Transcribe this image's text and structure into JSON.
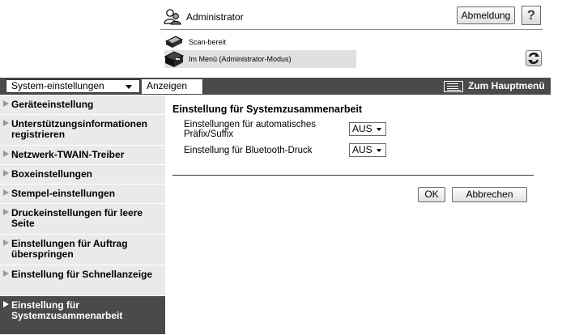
{
  "header": {
    "user_name": "Administrator",
    "logout_label": "Abmeldung",
    "help_label": "?",
    "status_scan": "Scan-bereit",
    "status_mode": "Im Menü (Administrator-Modus)"
  },
  "topbar": {
    "menu_select": "System-einstellungen",
    "display_label": "Anzeigen",
    "main_menu_label": "Zum Hauptmenü"
  },
  "sidebar": {
    "items": [
      {
        "label": "Geräteeinstellung"
      },
      {
        "label": "Unterstützungsinformationen registrieren"
      },
      {
        "label": "Netzwerk-TWAIN-Treiber"
      },
      {
        "label": "Boxeinstellungen"
      },
      {
        "label": "Stempel-einstellungen"
      },
      {
        "label": "Druckeinstellungen für leere Seite"
      },
      {
        "label": "Einstellungen für Auftrag überspringen"
      },
      {
        "label": "Einstellung für Schnellanzeige"
      },
      {
        "label": "Einstellung für Systemzusammenarbeit"
      }
    ]
  },
  "main": {
    "title": "Einstellung für Systemzusammenarbeit",
    "settings": [
      {
        "label": "Einstellungen für automatisches Präfix/Suffix",
        "value": "AUS"
      },
      {
        "label": "Einstellung für Bluetooth-Druck",
        "value": "AUS"
      }
    ],
    "ok_label": "OK",
    "cancel_label": "Abbrechen"
  },
  "colors": {
    "dark_bar": "#4a4a4a",
    "sidebar_bg": "#eaeaea",
    "status_bg": "#e0e0e0"
  }
}
